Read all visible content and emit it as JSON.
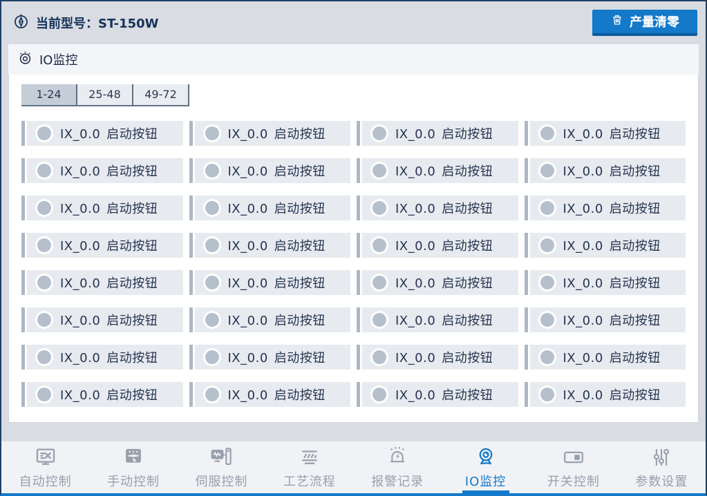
{
  "header": {
    "model_label": "当前型号：ST-150W",
    "clear_button": "产量清零"
  },
  "panel": {
    "title": "IO监控",
    "tabs": [
      {
        "label": "1-24",
        "active": true
      },
      {
        "label": "25-48",
        "active": false
      },
      {
        "label": "49-72",
        "active": false
      }
    ],
    "io_cells": [
      {
        "code": "IX_0.0",
        "name": "启动按钮",
        "state": "off"
      },
      {
        "code": "IX_0.0",
        "name": "启动按钮",
        "state": "off"
      },
      {
        "code": "IX_0.0",
        "name": "启动按钮",
        "state": "off"
      },
      {
        "code": "IX_0.0",
        "name": "启动按钮",
        "state": "off"
      },
      {
        "code": "IX_0.0",
        "name": "启动按钮",
        "state": "off"
      },
      {
        "code": "IX_0.0",
        "name": "启动按钮",
        "state": "off"
      },
      {
        "code": "IX_0.0",
        "name": "启动按钮",
        "state": "off"
      },
      {
        "code": "IX_0.0",
        "name": "启动按钮",
        "state": "off"
      },
      {
        "code": "IX_0.0",
        "name": "启动按钮",
        "state": "off"
      },
      {
        "code": "IX_0.0",
        "name": "启动按钮",
        "state": "off"
      },
      {
        "code": "IX_0.0",
        "name": "启动按钮",
        "state": "off"
      },
      {
        "code": "IX_0.0",
        "name": "启动按钮",
        "state": "off"
      },
      {
        "code": "IX_0.0",
        "name": "启动按钮",
        "state": "off"
      },
      {
        "code": "IX_0.0",
        "name": "启动按钮",
        "state": "off"
      },
      {
        "code": "IX_0.0",
        "name": "启动按钮",
        "state": "off"
      },
      {
        "code": "IX_0.0",
        "name": "启动按钮",
        "state": "off"
      },
      {
        "code": "IX_0.0",
        "name": "启动按钮",
        "state": "off"
      },
      {
        "code": "IX_0.0",
        "name": "启动按钮",
        "state": "off"
      },
      {
        "code": "IX_0.0",
        "name": "启动按钮",
        "state": "off"
      },
      {
        "code": "IX_0.0",
        "name": "启动按钮",
        "state": "off"
      },
      {
        "code": "IX_0.0",
        "name": "启动按钮",
        "state": "off"
      },
      {
        "code": "IX_0.0",
        "name": "启动按钮",
        "state": "off"
      },
      {
        "code": "IX_0.0",
        "name": "启动按钮",
        "state": "off"
      },
      {
        "code": "IX_0.0",
        "name": "启动按钮",
        "state": "off"
      },
      {
        "code": "IX_0.0",
        "name": "启动按钮",
        "state": "off"
      },
      {
        "code": "IX_0.0",
        "name": "启动按钮",
        "state": "off"
      },
      {
        "code": "IX_0.0",
        "name": "启动按钮",
        "state": "off"
      },
      {
        "code": "IX_0.0",
        "name": "启动按钮",
        "state": "off"
      },
      {
        "code": "IX_0.0",
        "name": "启动按钮",
        "state": "off"
      },
      {
        "code": "IX_0.0",
        "name": "启动按钮",
        "state": "off"
      },
      {
        "code": "IX_0.0",
        "name": "启动按钮",
        "state": "off"
      },
      {
        "code": "IX_0.0",
        "name": "启动按钮",
        "state": "off"
      }
    ]
  },
  "nav": {
    "items": [
      {
        "id": "auto-control",
        "label": "自动控制",
        "icon": "auto-control-icon",
        "active": false
      },
      {
        "id": "manual-control",
        "label": "手动控制",
        "icon": "manual-control-icon",
        "active": false
      },
      {
        "id": "servo-control",
        "label": "伺服控制",
        "icon": "servo-control-icon",
        "active": false
      },
      {
        "id": "process-flow",
        "label": "工艺流程",
        "icon": "process-flow-icon",
        "active": false
      },
      {
        "id": "alarm-record",
        "label": "报警记录",
        "icon": "alarm-record-icon",
        "active": false
      },
      {
        "id": "io-monitor",
        "label": "IO监控",
        "icon": "io-monitor-icon",
        "active": true
      },
      {
        "id": "switch-control",
        "label": "开关控制",
        "icon": "switch-control-icon",
        "active": false
      },
      {
        "id": "parameter-settings",
        "label": "参数设置",
        "icon": "parameter-settings-icon",
        "active": false
      }
    ]
  },
  "colors": {
    "accent_blue": "#1379c8",
    "button_shadow_blue": "#0c5a9e",
    "navy_text": "#16335b",
    "page_bg": "#d9dce2",
    "panel_bg": "#ffffff",
    "strip_bg": "#f4f5f8",
    "tab_active_bg": "#c5cdd7",
    "tab_bg": "#e9ecf1",
    "tab_border": "#5f7183",
    "cell_bg": "#e7eaef",
    "cell_accent_bar": "#adb7c3",
    "led_off": "#b6c0cd",
    "cell_text": "#253450",
    "nav_inactive": "#97a0ac"
  }
}
